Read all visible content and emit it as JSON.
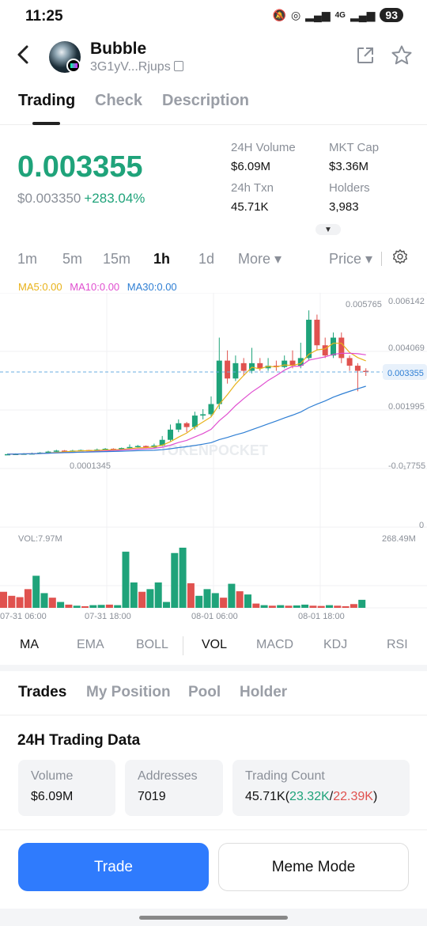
{
  "status_bar": {
    "time": "11:25",
    "network": "4G",
    "battery": "93"
  },
  "header": {
    "name": "Bubble",
    "address": "3G1yV...Rjups"
  },
  "tabs": [
    "Trading",
    "Check",
    "Description"
  ],
  "price": {
    "value": "0.003355",
    "usd": "$0.003350",
    "change": "+283.04%"
  },
  "stats": {
    "volume_label": "24H Volume",
    "volume": "$6.09M",
    "mktcap_label": "MKT Cap",
    "mktcap": "$3.36M",
    "txn_label": "24h Txn",
    "txn": "45.71K",
    "holders_label": "Holders",
    "holders": "3,983"
  },
  "intervals": [
    "1m",
    "5m",
    "15m",
    "1h",
    "1d",
    "More ▾",
    "Price ▾"
  ],
  "active_interval": "1h",
  "ma_legend": {
    "ma5": "MA5:0.00",
    "ma10": "MA10:0.00",
    "ma30": "MA30:0.00"
  },
  "chart_data": {
    "type": "candlestick",
    "y_axis": [
      "0.006142",
      "0.004069",
      "0.001995",
      "-0.0₁7755",
      "0"
    ],
    "current_price_label": "0.003355",
    "high_label": "0.005765",
    "low_label": "0.0001345",
    "volume_label": "VOL:7.97M",
    "volume_max": "268.49M",
    "x_labels": [
      "07-31 06:00",
      "07-31 18:00",
      "08-01 06:00",
      "08-01 18:00"
    ],
    "watermark": "TOKENPOCKET",
    "candles": [
      [
        0.00013,
        0.00014,
        0.00016,
        0.00012
      ],
      [
        0.00014,
        0.00015,
        0.00017,
        0.00013
      ],
      [
        0.00015,
        0.00016,
        0.00018,
        0.00014
      ],
      [
        0.00016,
        0.00017,
        0.0002,
        0.00015
      ],
      [
        0.00017,
        0.0002,
        0.00022,
        0.00016
      ],
      [
        0.0002,
        0.00024,
        0.00027,
        0.00019
      ],
      [
        0.00024,
        0.00028,
        0.00031,
        0.00022
      ],
      [
        0.00028,
        0.00026,
        0.0003,
        0.00024
      ],
      [
        0.00026,
        0.00028,
        0.00031,
        0.00024
      ],
      [
        0.00028,
        0.0003,
        0.00032,
        0.00026
      ],
      [
        0.0003,
        0.00027,
        0.00031,
        0.00026
      ],
      [
        0.00027,
        0.00032,
        0.00036,
        0.00026
      ],
      [
        0.00032,
        0.00035,
        0.00038,
        0.0003
      ],
      [
        0.00035,
        0.00031,
        0.00037,
        0.0003
      ],
      [
        0.00031,
        0.00038,
        0.0004,
        0.0003
      ],
      [
        0.00038,
        0.00042,
        0.00052,
        0.00036
      ],
      [
        0.00042,
        0.00046,
        0.0005,
        0.0004
      ],
      [
        0.00046,
        0.0004,
        0.00048,
        0.00038
      ],
      [
        0.0004,
        0.00048,
        0.00055,
        0.00038
      ],
      [
        0.00048,
        0.0007,
        0.00085,
        0.00045
      ],
      [
        0.0007,
        0.0011,
        0.0013,
        0.00065
      ],
      [
        0.0011,
        0.00135,
        0.0015,
        0.001
      ],
      [
        0.00135,
        0.0012,
        0.0014,
        0.001
      ],
      [
        0.0012,
        0.00165,
        0.0018,
        0.0011
      ],
      [
        0.00165,
        0.0017,
        0.0019,
        0.0015
      ],
      [
        0.0017,
        0.0021,
        0.0024,
        0.0016
      ],
      [
        0.0021,
        0.0038,
        0.0047,
        0.0019
      ],
      [
        0.0038,
        0.0031,
        0.0042,
        0.0029
      ],
      [
        0.0031,
        0.0037,
        0.004,
        0.003
      ],
      [
        0.0037,
        0.0034,
        0.0039,
        0.0032
      ],
      [
        0.0034,
        0.0037,
        0.0043,
        0.0033
      ],
      [
        0.0037,
        0.0035,
        0.0039,
        0.0034
      ],
      [
        0.0035,
        0.0036,
        0.0039,
        0.0034
      ],
      [
        0.0036,
        0.00355,
        0.0038,
        0.0034
      ],
      [
        0.00355,
        0.0038,
        0.004,
        0.0035
      ],
      [
        0.0038,
        0.0036,
        0.0042,
        0.0035
      ],
      [
        0.0036,
        0.0039,
        0.0045,
        0.0035
      ],
      [
        0.0039,
        0.0054,
        0.005765,
        0.0038
      ],
      [
        0.0054,
        0.0044,
        0.0056,
        0.0042
      ],
      [
        0.0044,
        0.004,
        0.0047,
        0.0039
      ],
      [
        0.004,
        0.0047,
        0.0049,
        0.0039
      ],
      [
        0.0047,
        0.0039,
        0.0049,
        0.0037
      ],
      [
        0.0039,
        0.0036,
        0.004,
        0.0034
      ],
      [
        0.0036,
        0.0034,
        0.0037,
        0.0026
      ],
      [
        0.0034,
        0.003355,
        0.0035,
        0.0032
      ]
    ],
    "volumes": [
      60,
      45,
      40,
      70,
      120,
      55,
      38,
      22,
      12,
      8,
      6,
      10,
      11,
      12,
      10,
      210,
      95,
      60,
      70,
      95,
      22,
      205,
      225,
      92,
      45,
      70,
      55,
      38,
      90,
      62,
      50,
      16,
      10,
      8,
      10,
      8,
      9,
      12,
      8,
      7,
      10,
      8,
      6,
      14,
      30
    ],
    "vol_up": [
      false,
      false,
      false,
      false,
      true,
      true,
      false,
      true,
      false,
      true,
      false,
      true,
      true,
      false,
      true,
      true,
      true,
      false,
      true,
      true,
      true,
      true,
      true,
      false,
      true,
      true,
      true,
      false,
      true,
      false,
      true,
      false,
      true,
      false,
      true,
      false,
      true,
      true,
      false,
      false,
      true,
      false,
      false,
      false,
      true
    ]
  },
  "indicators": [
    "MA",
    "EMA",
    "BOLL",
    "VOL",
    "MACD",
    "KDJ",
    "RSI"
  ],
  "tabs2": [
    "Trades",
    "My Position",
    "Pool",
    "Holder"
  ],
  "trading_section": {
    "title": "24H Trading Data",
    "volume_label": "Volume",
    "volume": "$6.09M",
    "addresses_label": "Addresses",
    "addresses": "7019",
    "count_label": "Trading Count",
    "count_total": "45.71K",
    "count_buy": "23.32K",
    "count_sell": "22.39K"
  },
  "buttons": {
    "trade": "Trade",
    "meme": "Meme Mode"
  },
  "colors": {
    "up": "#1fa37a",
    "down": "#e0524f",
    "accent": "#2f7bfd",
    "ma5": "#e8b21a",
    "ma10": "#e04fd0",
    "ma30": "#2f7fd4"
  }
}
